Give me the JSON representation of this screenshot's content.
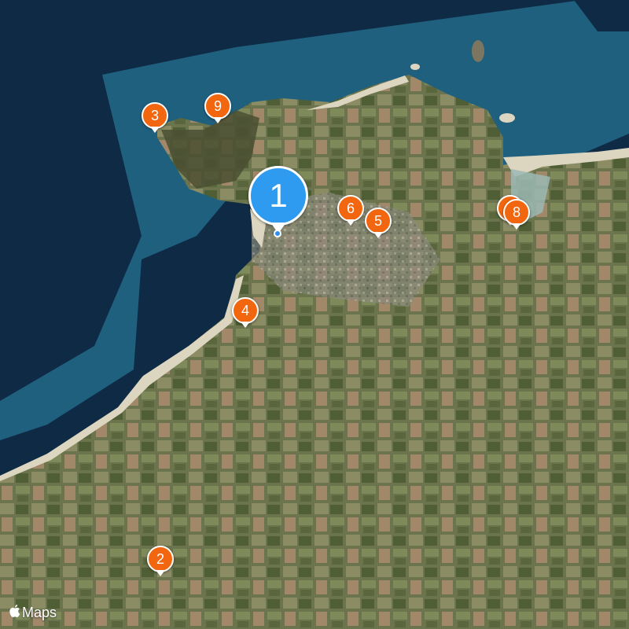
{
  "map": {
    "style": "satellite",
    "colors": {
      "deep_ocean": "#0e2a44",
      "shallow_ocean": "#20607f",
      "land": "#6f7752",
      "beach": "#dcd6c0",
      "pin": "#f2660f",
      "primary_pin": "#2f9bf0"
    }
  },
  "pins": [
    {
      "id": "1",
      "label": "1",
      "primary": true
    },
    {
      "id": "2",
      "label": "2"
    },
    {
      "id": "3",
      "label": "3"
    },
    {
      "id": "4",
      "label": "4"
    },
    {
      "id": "5",
      "label": "5"
    },
    {
      "id": "6",
      "label": "6"
    },
    {
      "id": "7",
      "label": "7"
    },
    {
      "id": "8",
      "label": "8"
    },
    {
      "id": "9",
      "label": "9"
    }
  ],
  "attribution": {
    "logo_icon": "apple-logo-icon",
    "text": "Maps"
  }
}
